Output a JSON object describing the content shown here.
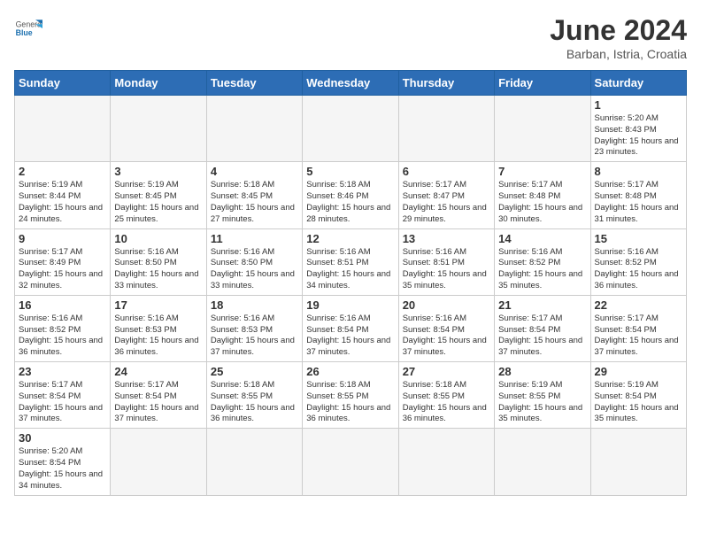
{
  "header": {
    "logo_general": "General",
    "logo_blue": "Blue",
    "title": "June 2024",
    "subtitle": "Barban, Istria, Croatia"
  },
  "weekdays": [
    "Sunday",
    "Monday",
    "Tuesday",
    "Wednesday",
    "Thursday",
    "Friday",
    "Saturday"
  ],
  "weeks": [
    [
      {
        "day": "",
        "info": ""
      },
      {
        "day": "",
        "info": ""
      },
      {
        "day": "",
        "info": ""
      },
      {
        "day": "",
        "info": ""
      },
      {
        "day": "",
        "info": ""
      },
      {
        "day": "",
        "info": ""
      },
      {
        "day": "1",
        "info": "Sunrise: 5:20 AM\nSunset: 8:43 PM\nDaylight: 15 hours\nand 23 minutes."
      }
    ],
    [
      {
        "day": "2",
        "info": "Sunrise: 5:19 AM\nSunset: 8:44 PM\nDaylight: 15 hours\nand 24 minutes."
      },
      {
        "day": "3",
        "info": "Sunrise: 5:19 AM\nSunset: 8:45 PM\nDaylight: 15 hours\nand 25 minutes."
      },
      {
        "day": "4",
        "info": "Sunrise: 5:18 AM\nSunset: 8:45 PM\nDaylight: 15 hours\nand 27 minutes."
      },
      {
        "day": "5",
        "info": "Sunrise: 5:18 AM\nSunset: 8:46 PM\nDaylight: 15 hours\nand 28 minutes."
      },
      {
        "day": "6",
        "info": "Sunrise: 5:17 AM\nSunset: 8:47 PM\nDaylight: 15 hours\nand 29 minutes."
      },
      {
        "day": "7",
        "info": "Sunrise: 5:17 AM\nSunset: 8:48 PM\nDaylight: 15 hours\nand 30 minutes."
      },
      {
        "day": "8",
        "info": "Sunrise: 5:17 AM\nSunset: 8:48 PM\nDaylight: 15 hours\nand 31 minutes."
      }
    ],
    [
      {
        "day": "9",
        "info": "Sunrise: 5:17 AM\nSunset: 8:49 PM\nDaylight: 15 hours\nand 32 minutes."
      },
      {
        "day": "10",
        "info": "Sunrise: 5:16 AM\nSunset: 8:50 PM\nDaylight: 15 hours\nand 33 minutes."
      },
      {
        "day": "11",
        "info": "Sunrise: 5:16 AM\nSunset: 8:50 PM\nDaylight: 15 hours\nand 33 minutes."
      },
      {
        "day": "12",
        "info": "Sunrise: 5:16 AM\nSunset: 8:51 PM\nDaylight: 15 hours\nand 34 minutes."
      },
      {
        "day": "13",
        "info": "Sunrise: 5:16 AM\nSunset: 8:51 PM\nDaylight: 15 hours\nand 35 minutes."
      },
      {
        "day": "14",
        "info": "Sunrise: 5:16 AM\nSunset: 8:52 PM\nDaylight: 15 hours\nand 35 minutes."
      },
      {
        "day": "15",
        "info": "Sunrise: 5:16 AM\nSunset: 8:52 PM\nDaylight: 15 hours\nand 36 minutes."
      }
    ],
    [
      {
        "day": "16",
        "info": "Sunrise: 5:16 AM\nSunset: 8:52 PM\nDaylight: 15 hours\nand 36 minutes."
      },
      {
        "day": "17",
        "info": "Sunrise: 5:16 AM\nSunset: 8:53 PM\nDaylight: 15 hours\nand 36 minutes."
      },
      {
        "day": "18",
        "info": "Sunrise: 5:16 AM\nSunset: 8:53 PM\nDaylight: 15 hours\nand 37 minutes."
      },
      {
        "day": "19",
        "info": "Sunrise: 5:16 AM\nSunset: 8:54 PM\nDaylight: 15 hours\nand 37 minutes."
      },
      {
        "day": "20",
        "info": "Sunrise: 5:16 AM\nSunset: 8:54 PM\nDaylight: 15 hours\nand 37 minutes."
      },
      {
        "day": "21",
        "info": "Sunrise: 5:17 AM\nSunset: 8:54 PM\nDaylight: 15 hours\nand 37 minutes."
      },
      {
        "day": "22",
        "info": "Sunrise: 5:17 AM\nSunset: 8:54 PM\nDaylight: 15 hours\nand 37 minutes."
      }
    ],
    [
      {
        "day": "23",
        "info": "Sunrise: 5:17 AM\nSunset: 8:54 PM\nDaylight: 15 hours\nand 37 minutes."
      },
      {
        "day": "24",
        "info": "Sunrise: 5:17 AM\nSunset: 8:54 PM\nDaylight: 15 hours\nand 37 minutes."
      },
      {
        "day": "25",
        "info": "Sunrise: 5:18 AM\nSunset: 8:55 PM\nDaylight: 15 hours\nand 36 minutes."
      },
      {
        "day": "26",
        "info": "Sunrise: 5:18 AM\nSunset: 8:55 PM\nDaylight: 15 hours\nand 36 minutes."
      },
      {
        "day": "27",
        "info": "Sunrise: 5:18 AM\nSunset: 8:55 PM\nDaylight: 15 hours\nand 36 minutes."
      },
      {
        "day": "28",
        "info": "Sunrise: 5:19 AM\nSunset: 8:55 PM\nDaylight: 15 hours\nand 35 minutes."
      },
      {
        "day": "29",
        "info": "Sunrise: 5:19 AM\nSunset: 8:54 PM\nDaylight: 15 hours\nand 35 minutes."
      }
    ],
    [
      {
        "day": "30",
        "info": "Sunrise: 5:20 AM\nSunset: 8:54 PM\nDaylight: 15 hours\nand 34 minutes."
      },
      {
        "day": "",
        "info": ""
      },
      {
        "day": "",
        "info": ""
      },
      {
        "day": "",
        "info": ""
      },
      {
        "day": "",
        "info": ""
      },
      {
        "day": "",
        "info": ""
      },
      {
        "day": "",
        "info": ""
      }
    ]
  ]
}
